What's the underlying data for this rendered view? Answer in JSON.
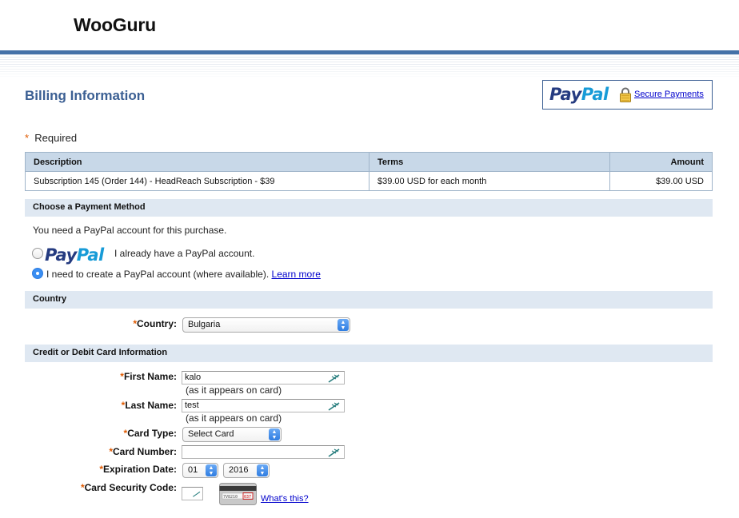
{
  "header": {
    "brand": "WooGuru"
  },
  "billing": {
    "title": "Billing Information",
    "secure": {
      "logo_pay": "Pay",
      "logo_pal": "Pal",
      "link": "Secure Payments",
      "icon": "lock-icon"
    },
    "required_marker": "*",
    "required_label": "Required"
  },
  "summary": {
    "headers": {
      "description": "Description",
      "terms": "Terms",
      "amount": "Amount"
    },
    "row": {
      "description": "Subscription 145 (Order 144) - HeadReach Subscription - $39",
      "terms": "$39.00 USD for each month",
      "amount": "$39.00 USD"
    }
  },
  "payment_method": {
    "heading": "Choose a Payment Method",
    "intro": "You need a PayPal account for this purchase.",
    "logo_pay": "Pay",
    "logo_pal": "Pal",
    "option_existing": "I already have a PayPal account.",
    "option_create": "I need to create a PayPal account (where available).",
    "learn_more": "Learn more",
    "selected": "create"
  },
  "country": {
    "heading": "Country",
    "label": "Country:",
    "value": "Bulgaria"
  },
  "card": {
    "heading": "Credit or Debit Card Information",
    "first_name_label": "First Name:",
    "first_name_value": "kalo",
    "last_name_label": "Last Name:",
    "last_name_value": "test",
    "as_on_card": "(as it appears on card)",
    "card_type_label": "Card Type:",
    "card_type_value": "Select Card",
    "card_number_label": "Card Number:",
    "card_number_value": "",
    "expiration_label": "Expiration Date:",
    "exp_month": "01",
    "exp_year": "2016",
    "csc_label": "Card Security Code:",
    "csc_value": "",
    "cvv_sample": "7V8210",
    "cvv_code": "037",
    "whats_this": "What's this?"
  },
  "colors": {
    "accent": "#3b5f93",
    "bar": "#4471a8",
    "section_bg": "#dfe8f2",
    "table_head": "#c8d8e8",
    "required": "#e05a00",
    "link": "#0000cc"
  }
}
